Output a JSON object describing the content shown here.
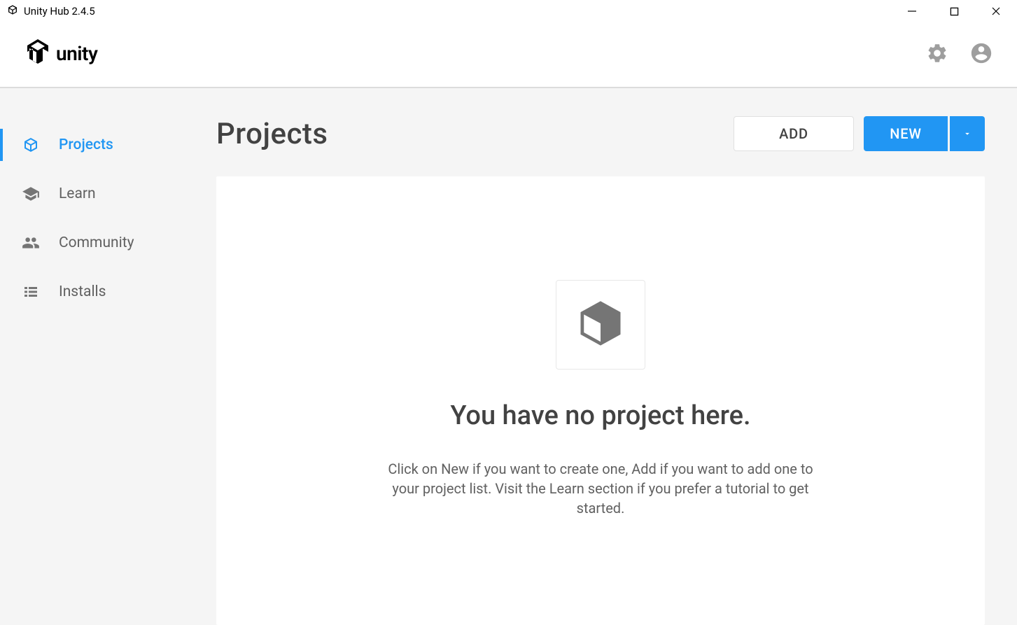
{
  "titlebar": {
    "title": "Unity Hub 2.4.5"
  },
  "sidebar": {
    "items": [
      {
        "label": "Projects",
        "icon": "cube-icon",
        "active": true
      },
      {
        "label": "Learn",
        "icon": "graduation-cap-icon",
        "active": false
      },
      {
        "label": "Community",
        "icon": "people-icon",
        "active": false
      },
      {
        "label": "Installs",
        "icon": "list-icon",
        "active": false
      }
    ]
  },
  "main": {
    "title": "Projects",
    "add_label": "ADD",
    "new_label": "NEW"
  },
  "empty": {
    "title": "You have no project here.",
    "desc": "Click on New if you want to create one, Add if you want to add one to your project list. Visit the Learn section if you prefer a tutorial to get started."
  }
}
